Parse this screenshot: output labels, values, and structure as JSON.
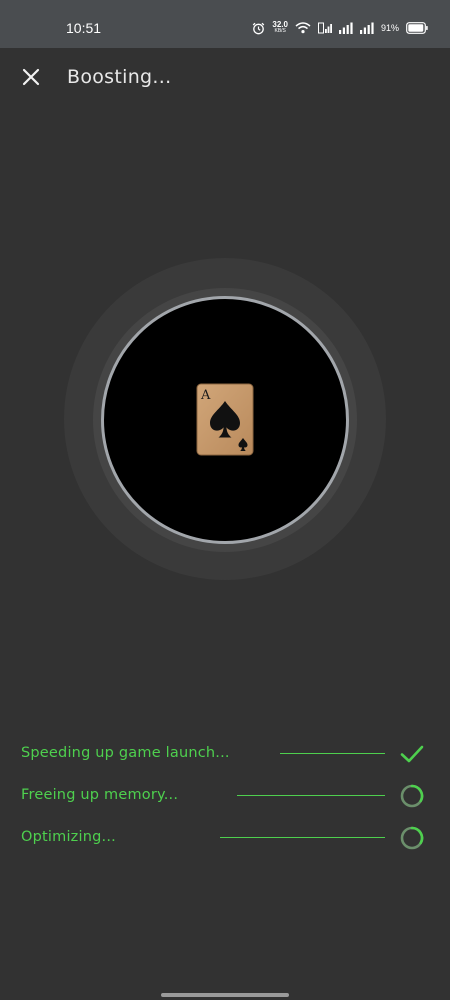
{
  "status_bar": {
    "time": "10:51",
    "net_speed_value": "32.0",
    "net_speed_unit": "KB/S",
    "battery_percent": "91%",
    "icons": [
      "alarm-icon",
      "net-speed",
      "wifi-icon",
      "volte-icon",
      "signal-icon",
      "signal-icon",
      "battery-icon"
    ]
  },
  "header": {
    "close_icon": "close-icon",
    "title": "Boosting..."
  },
  "boost": {
    "game_icon": "ace-of-spades-card-icon",
    "card_rank": "A"
  },
  "steps": [
    {
      "label": "Speeding up game launch...",
      "status": "done",
      "icon": "check-icon"
    },
    {
      "label": "Freeing up memory...",
      "status": "in-progress",
      "icon": "spinner-icon"
    },
    {
      "label": "Optimizing...",
      "status": "in-progress",
      "icon": "spinner-icon"
    }
  ],
  "colors": {
    "background": "#323232",
    "status_bar": "#4a4d50",
    "accent_green": "#4ed04e",
    "ring_border": "#a2a6ab"
  }
}
